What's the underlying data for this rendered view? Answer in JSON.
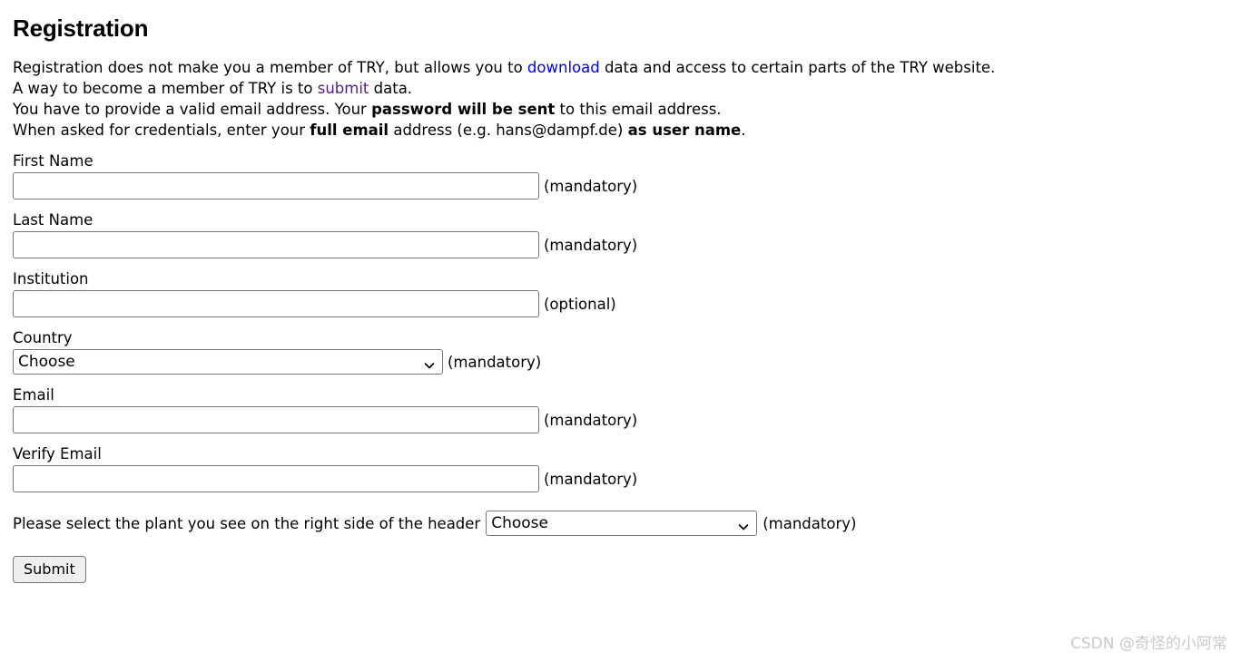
{
  "page": {
    "title": "Registration"
  },
  "intro": {
    "line1": {
      "before_link": "Registration does not make you a member of TRY, but allows you to ",
      "link": "download",
      "after_link": " data and access to certain parts of the TRY website."
    },
    "line2": {
      "before_link": "A way to become a member of TRY is to ",
      "link": "submit",
      "after_link": " data."
    },
    "line3": {
      "before_bold": "You have to provide a valid email address. Your ",
      "bold": "password will be sent",
      "after_bold": " to this email address."
    },
    "line4": {
      "part1": "When asked for credentials, enter your ",
      "bold1": "full email",
      "part2": " address (e.g. hans@dampf.de) ",
      "bold2": "as user name",
      "part3": "."
    }
  },
  "fields": {
    "first_name": {
      "label": "First Name",
      "value": "",
      "placeholder": "",
      "hint": "(mandatory)"
    },
    "last_name": {
      "label": "Last Name",
      "value": "",
      "placeholder": "",
      "hint": "(mandatory)"
    },
    "institution": {
      "label": "Institution",
      "value": "",
      "placeholder": "",
      "hint": "(optional)"
    },
    "country": {
      "label": "Country",
      "value": "Choose",
      "hint": "(mandatory)"
    },
    "email": {
      "label": "Email",
      "value": "",
      "placeholder": "",
      "hint": "(mandatory)"
    },
    "verify_email": {
      "label": "Verify Email",
      "value": "",
      "placeholder": "",
      "hint": "(mandatory)"
    },
    "plant": {
      "label": "Please select the plant you see on the right side of the header",
      "value": "Choose",
      "hint": "(mandatory)"
    }
  },
  "actions": {
    "submit_label": "Submit"
  },
  "watermark": {
    "text": "CSDN @奇怪的小阿常"
  },
  "colors": {
    "link_unvisited": "#0000ee",
    "link_visited": "#551a8b",
    "input_border": "#767676",
    "button_bg": "#efefef",
    "watermark": "#c9c9c9"
  }
}
